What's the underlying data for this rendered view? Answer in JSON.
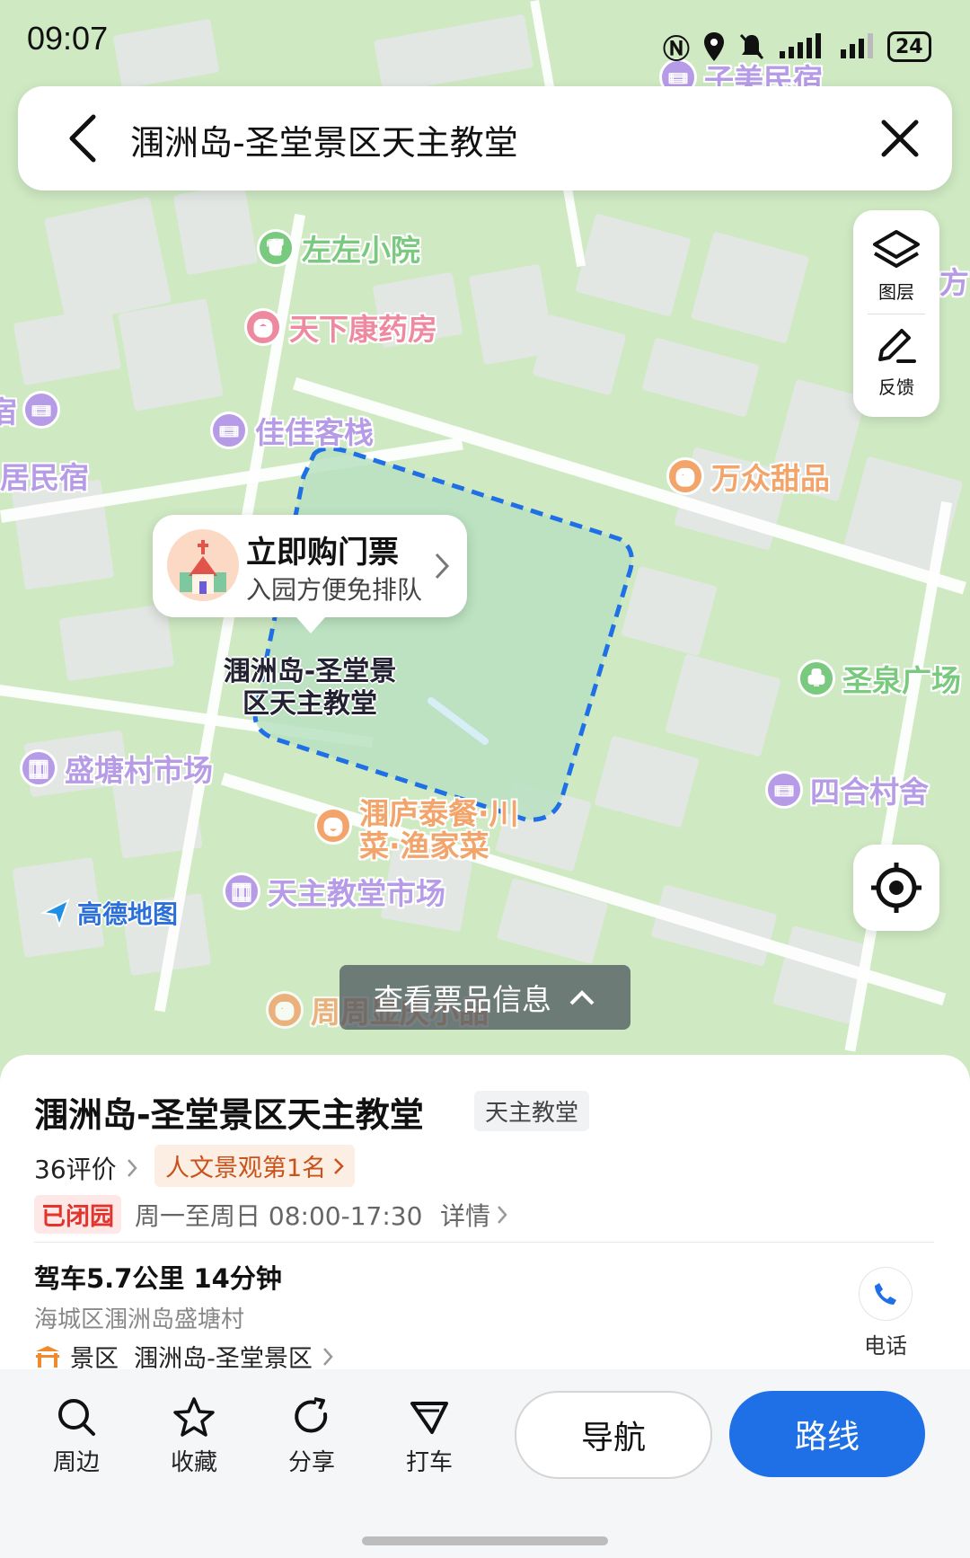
{
  "status_bar": {
    "time": "09:07",
    "battery": "24"
  },
  "search": {
    "query": "涠洲岛-圣堂景区天主教堂"
  },
  "map_tools": {
    "layers_label": "图层",
    "feedback_label": "反馈"
  },
  "map_labels": {
    "poi_zimei": "子美民宿",
    "poi_zuozuo": "左左小院",
    "poi_tianxia": "天下康药房",
    "poi_jiajia": "佳佳客栈",
    "poi_wanzhong": "万众甜品",
    "poi_shengquan": "圣泉广场",
    "poi_shengtang_market": "盛塘村市场",
    "poi_siheshe": "四合村舍",
    "poi_weilu_line1": "涠庐泰餐·川",
    "poi_weilu_line2": "菜·渔家菜",
    "poi_church_market": "天主教堂市场",
    "poi_zhouzhou": "周周显庆小品",
    "left_edge_1": "宿",
    "left_edge_2": "居民宿",
    "right_edge": "方",
    "target_label_line1": "涠洲岛-圣堂景",
    "target_label_line2": "区天主教堂",
    "amap_logo": "高德地图"
  },
  "callout": {
    "title": "立即购门票",
    "subtitle": "入园方便免排队"
  },
  "ticket_button": {
    "label": "查看票品信息"
  },
  "place": {
    "name": "涠洲岛-圣堂景区天主教堂",
    "category": "天主教堂",
    "reviews": "36评价",
    "rank_badge": "人文景观第1名",
    "open_status": "已闭园",
    "hours": "周一至周日 08:00-17:30",
    "details_link": "详情",
    "drive_info": "驾车5.7公里 14分钟",
    "address": "海城区涠洲岛盛塘村",
    "scenic_area": "景区  涠洲岛-圣堂景区",
    "phone_label": "电话"
  },
  "actions": {
    "nearby": "周边",
    "favorite": "收藏",
    "share": "分享",
    "taxi": "打车",
    "navigate": "导航",
    "route": "路线"
  },
  "colors": {
    "map_green": "#cfe9c3",
    "building_gray": "#e2e7e3",
    "accent_blue": "#1f6fe6",
    "closed_red": "#e0342c",
    "poi_purple": "#b69be6",
    "poi_orange": "#f2a46b",
    "poi_green": "#79c97f",
    "poi_pink": "#ee8aa0"
  }
}
